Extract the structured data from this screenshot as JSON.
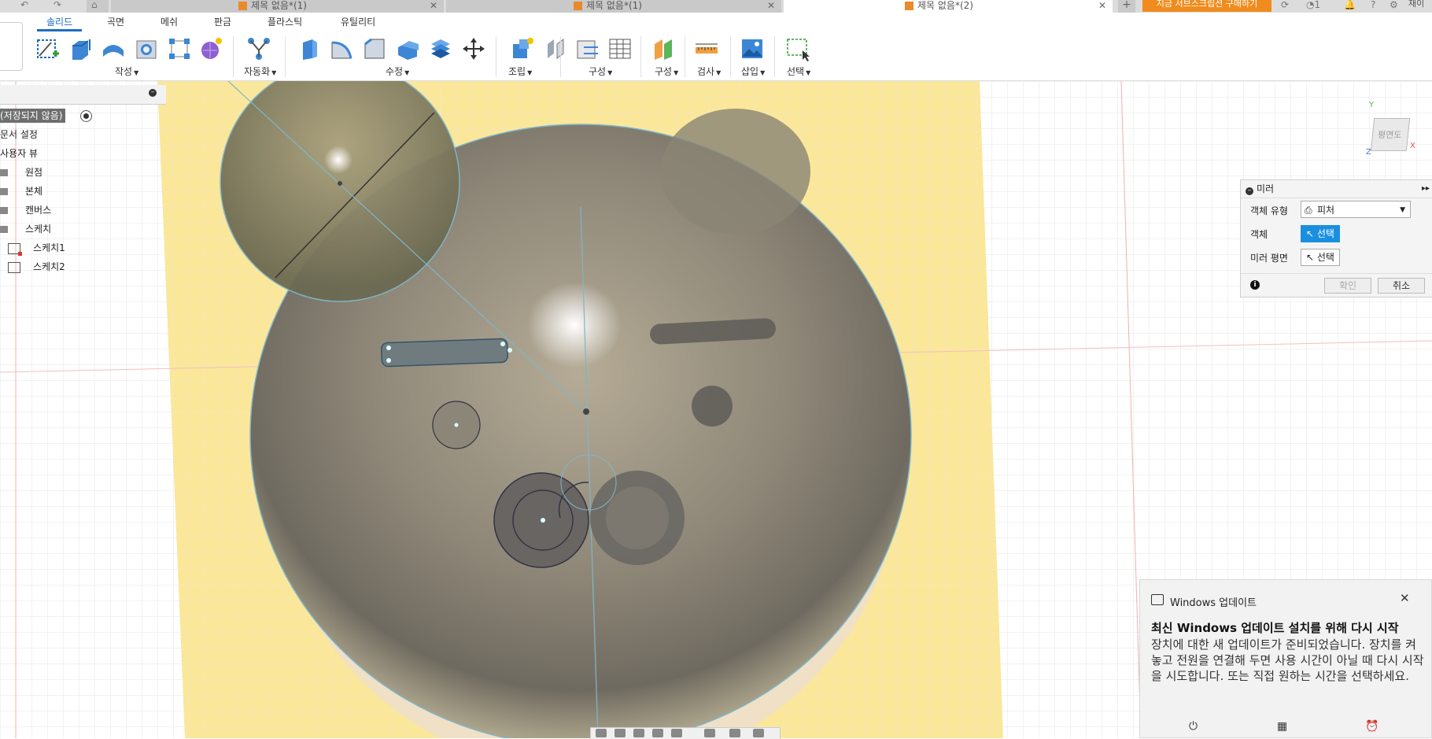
{
  "tabs": [
    {
      "label": "제목 없음*(1)",
      "active": false
    },
    {
      "label": "제목 없음*(1)",
      "active": false
    },
    {
      "label": "제목 없음*(2)",
      "active": true
    }
  ],
  "topbar": {
    "subscribe_label": "지금 서브스크립션 구매하기",
    "job_count": "1",
    "user": "재이"
  },
  "workspace_tabs": [
    "솔리드",
    "곡면",
    "메쉬",
    "판금",
    "플라스틱",
    "유틸리티"
  ],
  "toolbar_groups": [
    "작성",
    "자동화",
    "수정",
    "조립",
    "구성",
    "구성",
    "검사",
    "삽입",
    "선택"
  ],
  "browser": {
    "root": "(저장되지 않음)",
    "items": [
      "문서 설정",
      "사용자 뷰",
      "원점",
      "본체",
      "캔버스",
      "스케치",
      "스케치1",
      "스케치2"
    ]
  },
  "mirror_dialog": {
    "title": "미러",
    "type_label": "객체 유형",
    "type_value": "피처",
    "object_label": "객체",
    "object_value": "선택",
    "plane_label": "미러 평면",
    "plane_value": "선택",
    "ok": "확인",
    "cancel": "취소"
  },
  "viewcube": {
    "face": "평면도",
    "axis_x": "X",
    "axis_y": "Y",
    "axis_z": "Z"
  },
  "notification": {
    "app": "Windows 업데이트",
    "title": "최신 Windows 업데이트 설치를 위해 다시 시작",
    "body": "장치에 대한 새 업데이트가 준비되었습니다. 장치를 켜 놓고 전원을 연결해 두면 사용 시간이 아닐 때 다시 시작을 시도합니다. 또는 직접 원하는 시간을 선택하세요."
  },
  "colors": {
    "accent": "#1a6fc0",
    "subscribe": "#f08c1d",
    "canvas": "#fbe79a",
    "select_btn": "#1a8fe0"
  }
}
